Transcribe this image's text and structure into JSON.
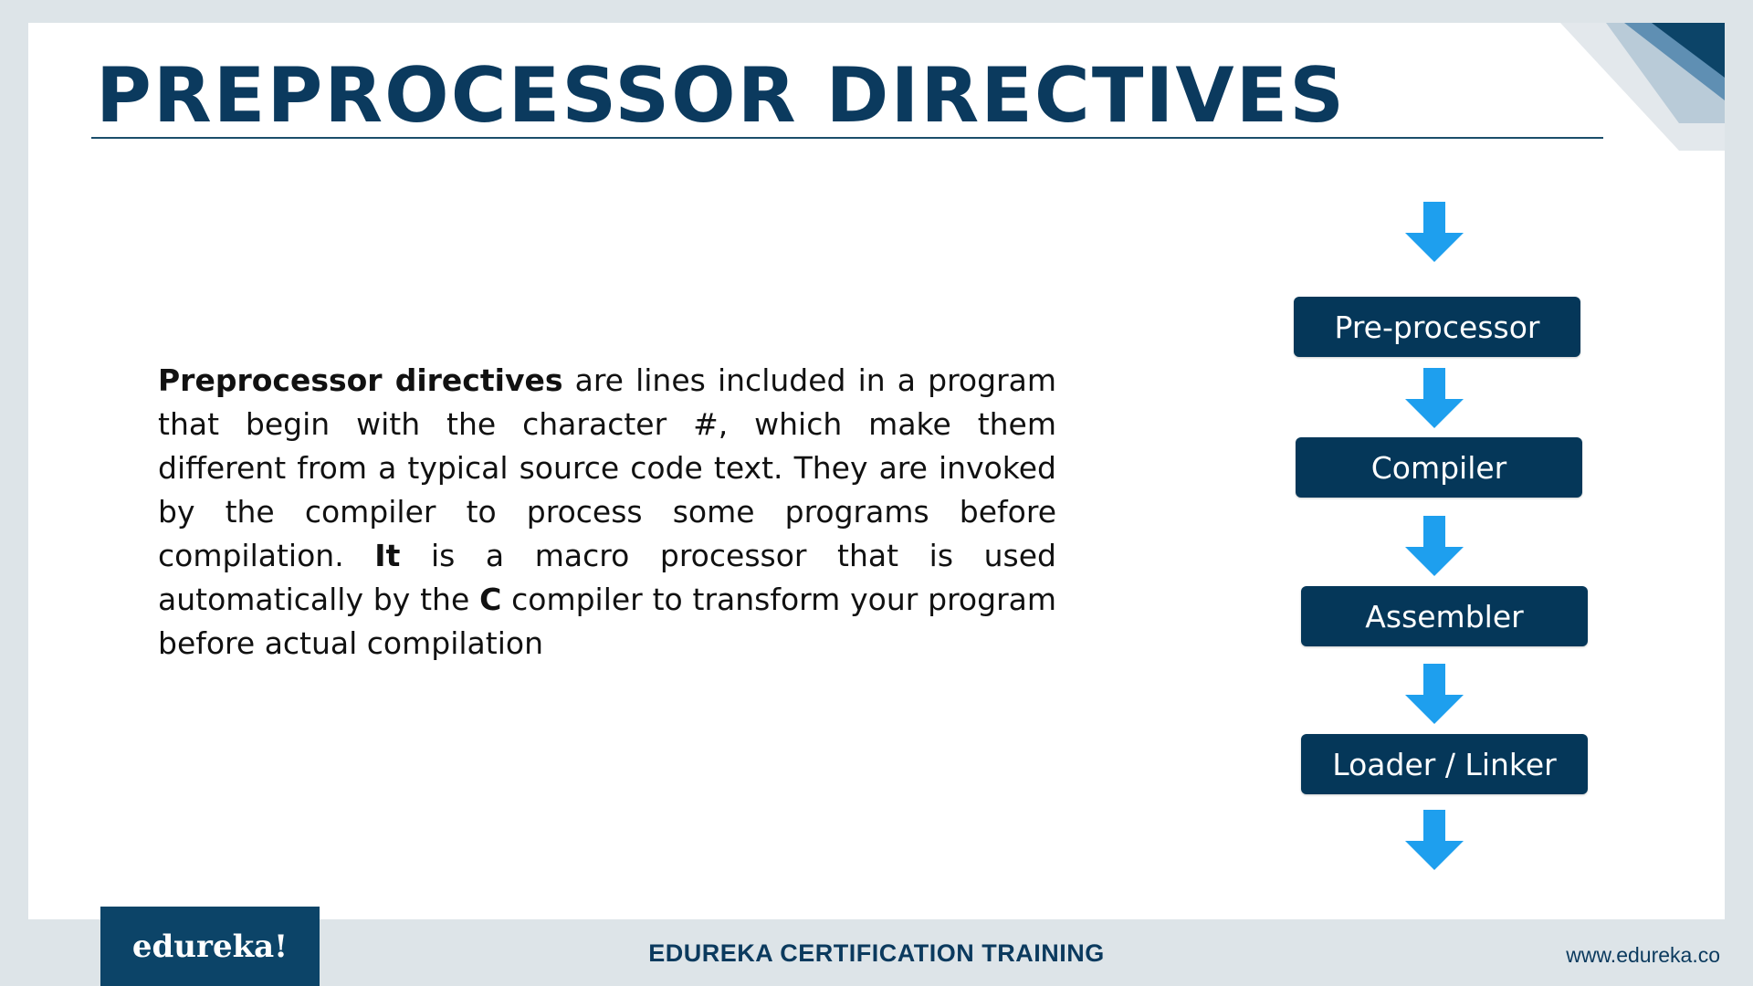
{
  "slide": {
    "title": "PREPROCESSOR DIRECTIVES",
    "body": {
      "segments": [
        {
          "text": "Preprocessor directives",
          "bold": true
        },
        {
          "text": " are lines included in a program that begin with the character #, which make them different from a typical source code text. They are invoked by the compiler to process some programs before compilation. ",
          "bold": false
        },
        {
          "text": "It",
          "bold": true
        },
        {
          "text": " is a macro processor that is used automatically by the ",
          "bold": false
        },
        {
          "text": "C",
          "bold": true
        },
        {
          "text": " compiler to transform your program before actual compilation",
          "bold": false
        }
      ]
    },
    "flow": {
      "steps": [
        "Pre-processor",
        "Compiler",
        "Assembler",
        "Loader / Linker"
      ],
      "arrow_color": "#1e9fee",
      "box_color": "#053759"
    }
  },
  "footer": {
    "logo": "edureka!",
    "center": "EDUREKA CERTIFICATION TRAINING",
    "url": "www.edureka.co"
  }
}
